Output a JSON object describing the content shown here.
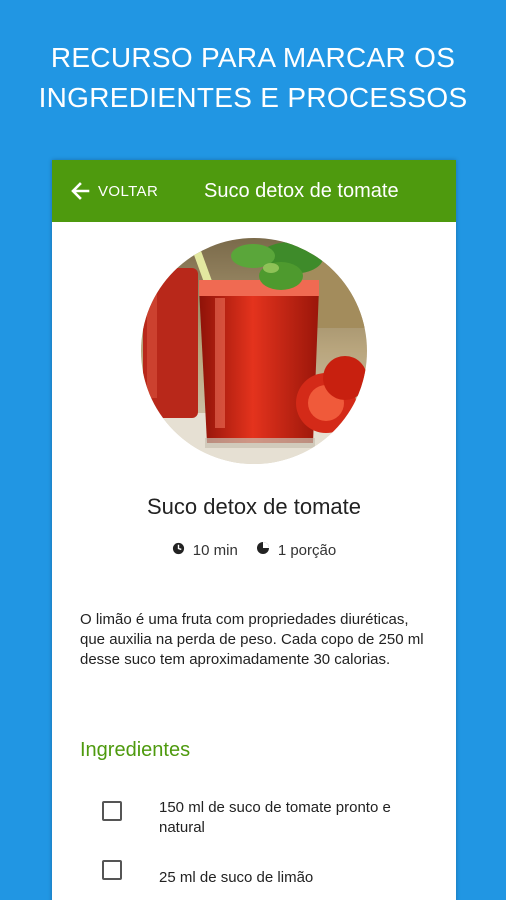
{
  "promo": {
    "line1": "RECURSO PARA MARCAR OS",
    "line2": "INGREDIENTES E PROCESSOS"
  },
  "appbar": {
    "back_label": "VOLTAR",
    "title": "Suco detox de tomate",
    "color": "#4e9a0e"
  },
  "recipe": {
    "title": "Suco detox de tomate",
    "time": "10 min",
    "portions": "1 porção",
    "description": "O limão é uma fruta com propriedades diuréticas, que auxilia na perda de peso. Cada copo de 250 ml desse suco tem aproximadamente 30 calorias."
  },
  "ingredients": {
    "title": "Ingredientes",
    "items": [
      {
        "label": "150 ml de suco de tomate pronto e natural",
        "checked": false
      },
      {
        "label": "25 ml de suco de limão",
        "checked": false
      }
    ]
  },
  "colors": {
    "background": "#2196e3",
    "accent": "#4e9a0e"
  }
}
